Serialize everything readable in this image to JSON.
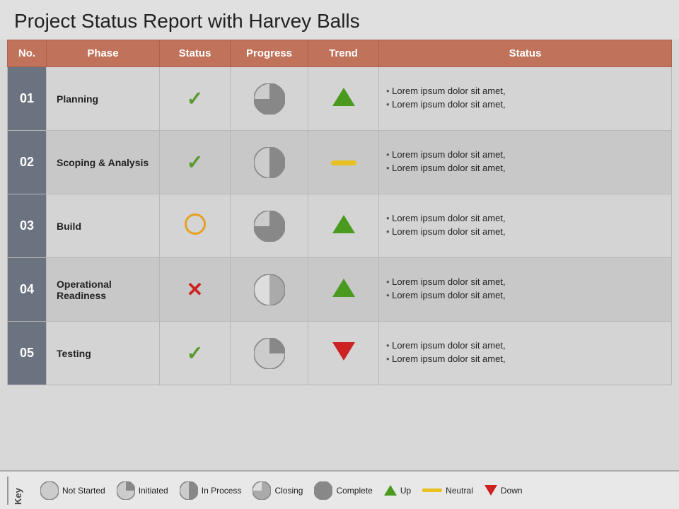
{
  "title": "Project Status Report with Harvey Balls",
  "header": {
    "col_no": "No.",
    "col_phase": "Phase",
    "col_status": "Status",
    "col_progress": "Progress",
    "col_trend": "Trend",
    "col_status_notes": "Status"
  },
  "rows": [
    {
      "no": "01",
      "phase": "Planning",
      "status_type": "check",
      "progress_fill": 75,
      "trend_type": "up",
      "notes": [
        "Lorem ipsum dolor sit amet,",
        "Lorem ipsum dolor sit amet,"
      ]
    },
    {
      "no": "02",
      "phase": "Scoping & Analysis",
      "status_type": "check",
      "progress_fill": 50,
      "trend_type": "neutral",
      "notes": [
        "Lorem ipsum dolor sit amet,",
        "Lorem ipsum dolor sit amet,"
      ]
    },
    {
      "no": "03",
      "phase": "Build",
      "status_type": "circle",
      "progress_fill": 75,
      "trend_type": "up",
      "notes": [
        "Lorem ipsum dolor sit amet,",
        "Lorem ipsum dolor sit amet,"
      ]
    },
    {
      "no": "04",
      "phase": "Operational Readiness",
      "status_type": "x",
      "progress_fill": 50,
      "trend_type": "up",
      "notes": [
        "Lorem ipsum dolor sit amet,",
        "Lorem ipsum dolor sit amet,"
      ]
    },
    {
      "no": "05",
      "phase": "Testing",
      "status_type": "check",
      "progress_fill": 25,
      "trend_type": "down",
      "notes": [
        "Lorem ipsum dolor sit amet,",
        "Lorem ipsum dolor sit amet,"
      ]
    }
  ],
  "legend": {
    "key_label": "Key",
    "items": [
      {
        "label": "Not Started",
        "type": "harvey",
        "fill": 0
      },
      {
        "label": "Initiated",
        "type": "harvey",
        "fill": 25
      },
      {
        "label": "In Process",
        "type": "harvey",
        "fill": 50
      },
      {
        "label": "Closing",
        "type": "harvey",
        "fill": 75
      },
      {
        "label": "Complete",
        "type": "harvey",
        "fill": 100
      },
      {
        "label": "Up",
        "type": "arrow-up"
      },
      {
        "label": "Neutral",
        "type": "dash"
      },
      {
        "label": "Down",
        "type": "arrow-down"
      }
    ]
  }
}
